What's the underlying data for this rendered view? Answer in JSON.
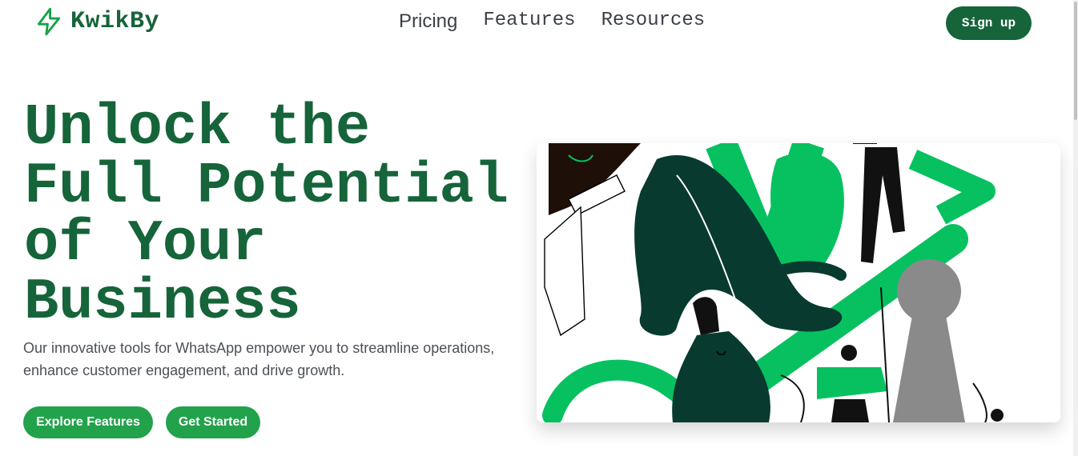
{
  "header": {
    "brand": "KwikBy",
    "logo_icon": "lightning-bolt-icon",
    "nav": [
      {
        "label": "Pricing"
      },
      {
        "label": "Features"
      },
      {
        "label": "Resources"
      }
    ],
    "signup_label": "Sign up"
  },
  "hero": {
    "title_lines": [
      "Unlock the",
      "Full Potential",
      "of Your",
      "Business"
    ],
    "subtitle": "Our innovative tools for WhatsApp empower you to streamline operations, enhance customer engagement, and drive growth.",
    "buttons": [
      {
        "label": "Explore Features"
      },
      {
        "label": "Get Started"
      }
    ],
    "illustration": "people-climbing-growth-arrow-illustration"
  },
  "colors": {
    "brand_dark": "#16643a",
    "brand_green": "#22a24a",
    "illustration_green": "#07c160",
    "illustration_dark": "#083a30"
  }
}
